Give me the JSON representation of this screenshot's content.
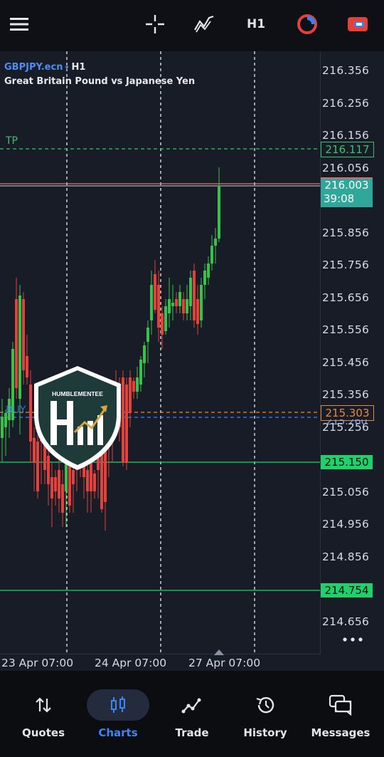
{
  "toolbar": {
    "timeframe": "H1"
  },
  "symbol": {
    "name": "GBPJPY.ecn",
    "timeframe": "H1",
    "description": "Great Britain Pound vs Japanese Yen"
  },
  "price_axis": [
    "216.356",
    "216.256",
    "216.156",
    "216.056",
    "215.856",
    "215.756",
    "215.656",
    "215.556",
    "215.456",
    "215.356",
    "215.256",
    "215.056",
    "214.956",
    "214.856",
    "214.656"
  ],
  "time_axis": [
    "23 Apr 07:00",
    "24 Apr 07:00",
    "27 Apr 07:00"
  ],
  "levels": {
    "tp": {
      "label": "TP",
      "price": "216.117",
      "color": "#3cc06b"
    },
    "current": {
      "price": "216.003",
      "countdown": "39:08",
      "color": "#2fa89b"
    },
    "buy_label": "BUY",
    "order": {
      "price": "215.303",
      "color": "#e58b3a"
    },
    "buy_line_price": "215.260",
    "green1": {
      "price": "215.150",
      "color": "#1fd16a"
    },
    "green2": {
      "price": "214.754",
      "color": "#1fd16a"
    }
  },
  "watermark": {
    "text": "HUMBLEMENTEE",
    "monogram": "HM"
  },
  "nav": {
    "items": [
      {
        "label": "Quotes",
        "icon": "arrows-updown-icon"
      },
      {
        "label": "Charts",
        "icon": "candles-icon"
      },
      {
        "label": "Trade",
        "icon": "trade-line-icon"
      },
      {
        "label": "History",
        "icon": "history-icon"
      },
      {
        "label": "Messages",
        "icon": "messages-icon"
      }
    ],
    "active": "Charts"
  },
  "colors": {
    "bull": "#39c24a",
    "bear": "#e2423b",
    "accent": "#3d86f5"
  }
}
